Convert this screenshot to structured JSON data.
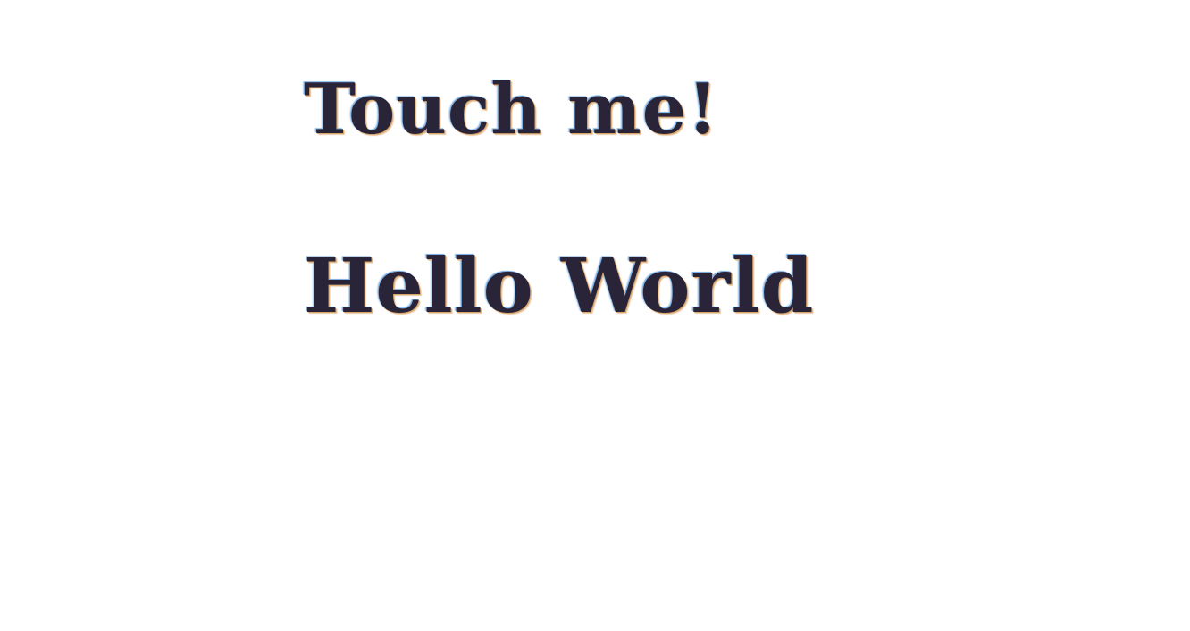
{
  "touch_label": "Touch me!",
  "hello_label": "Hello World",
  "colors": {
    "background": "#ffffff",
    "text": "#2a2438"
  }
}
